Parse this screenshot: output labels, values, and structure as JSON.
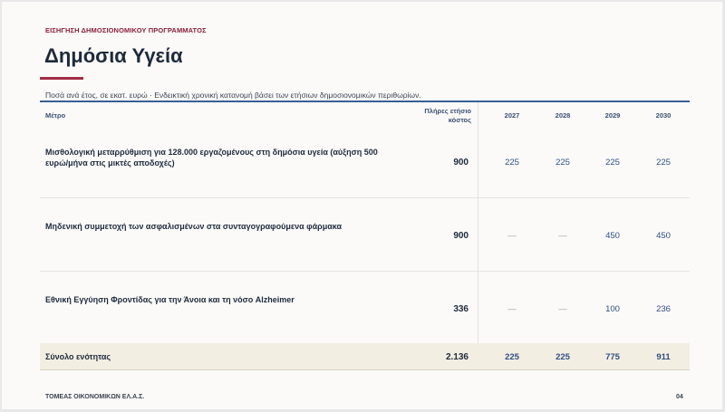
{
  "header": {
    "kicker": "ΕΙΣΗΓΗΣΗ ΔΗΜΟΣΙΟΝΟΜΙΚΟΥ ΠΡΟΓΡΑΜΜΑΤΟΣ",
    "title": "Δημόσια Υγεία",
    "subtitle": "Ποσά ανά έτος, σε εκατ. ευρώ · Ενδεικτική χρονική κατανομή βάσει των ετήσιων δημοσιονομικών περιθωρίων."
  },
  "table": {
    "columns": {
      "measure": "Μέτρο",
      "full_cost": "Πλήρες ετήσιο κόστος",
      "y2027": "2027",
      "y2028": "2028",
      "y2029": "2029",
      "y2030": "2030"
    },
    "rows": [
      {
        "label": "Μισθολογική μεταρρύθμιση για 128.000 εργαζομένους στη δημόσια υγεία (αύξηση 500 ευρώ/μήνα στις μικτές αποδοχές)",
        "full_cost": "900",
        "y2027": "225",
        "y2028": "225",
        "y2029": "225",
        "y2030": "225"
      },
      {
        "label": "Μηδενική συμμετοχή των ασφαλισμένων στα συνταγογραφούμενα φάρμακα",
        "full_cost": "900",
        "y2027": "—",
        "y2028": "—",
        "y2029": "450",
        "y2030": "450"
      },
      {
        "label": "Εθνική Εγγύηση Φροντίδας για την Άνοια και τη νόσο Alzheimer",
        "full_cost": "336",
        "y2027": "—",
        "y2028": "—",
        "y2029": "100",
        "y2030": "236"
      }
    ],
    "total": {
      "label": "Σύνολο ενότητας",
      "full_cost": "2.136",
      "y2027": "225",
      "y2028": "225",
      "y2029": "775",
      "y2030": "911"
    }
  },
  "footer": {
    "org": "ΤΟΜΕΑΣ ΟΙΚΟΝΟΜΙΚΩΝ ΕΛ.Α.Σ.",
    "page": "04"
  }
}
